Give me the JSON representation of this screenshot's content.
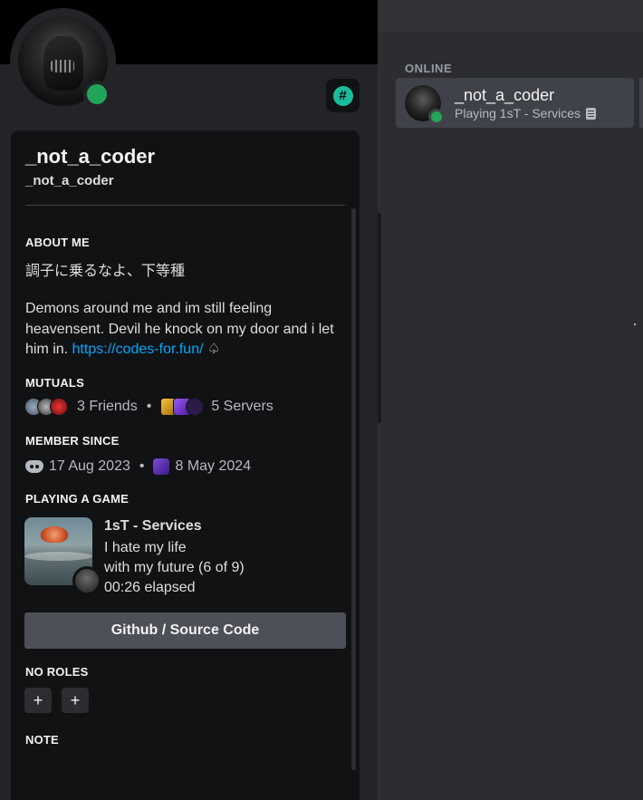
{
  "profile": {
    "display_name": "_not_a_coder",
    "username": "_not_a_coder",
    "hash_badge": "#",
    "about_title": "ABOUT ME",
    "about_jp": "調子に乗るなよ、下等種",
    "about_bio": "Demons around me and im still feeling heavensent. Devil he knock on my door and i let him in.",
    "about_link": "https://codes-for.fun/",
    "about_symbol": "♤",
    "mutuals_title": "MUTUALS",
    "mutual_friends": "3 Friends",
    "mutual_servers": "5 Servers",
    "separator": "•",
    "member_since_title": "MEMBER SINCE",
    "discord_since": "17 Aug 2023",
    "server_since": "8 May 2024",
    "playing_title": "PLAYING A GAME",
    "game": {
      "name": "1sT - Services",
      "details": "I hate my life",
      "state": "with my future (6 of 9)",
      "elapsed": "00:26 elapsed"
    },
    "github_button": "Github / Source Code",
    "roles_title": "NO ROLES",
    "role_add": "+",
    "note_title": "NOTE",
    "status_color": "#23a559"
  },
  "member_list": {
    "online_header": "ONLINE",
    "member": {
      "name": "_not_a_coder",
      "activity": "Playing 1sT - Services"
    }
  }
}
